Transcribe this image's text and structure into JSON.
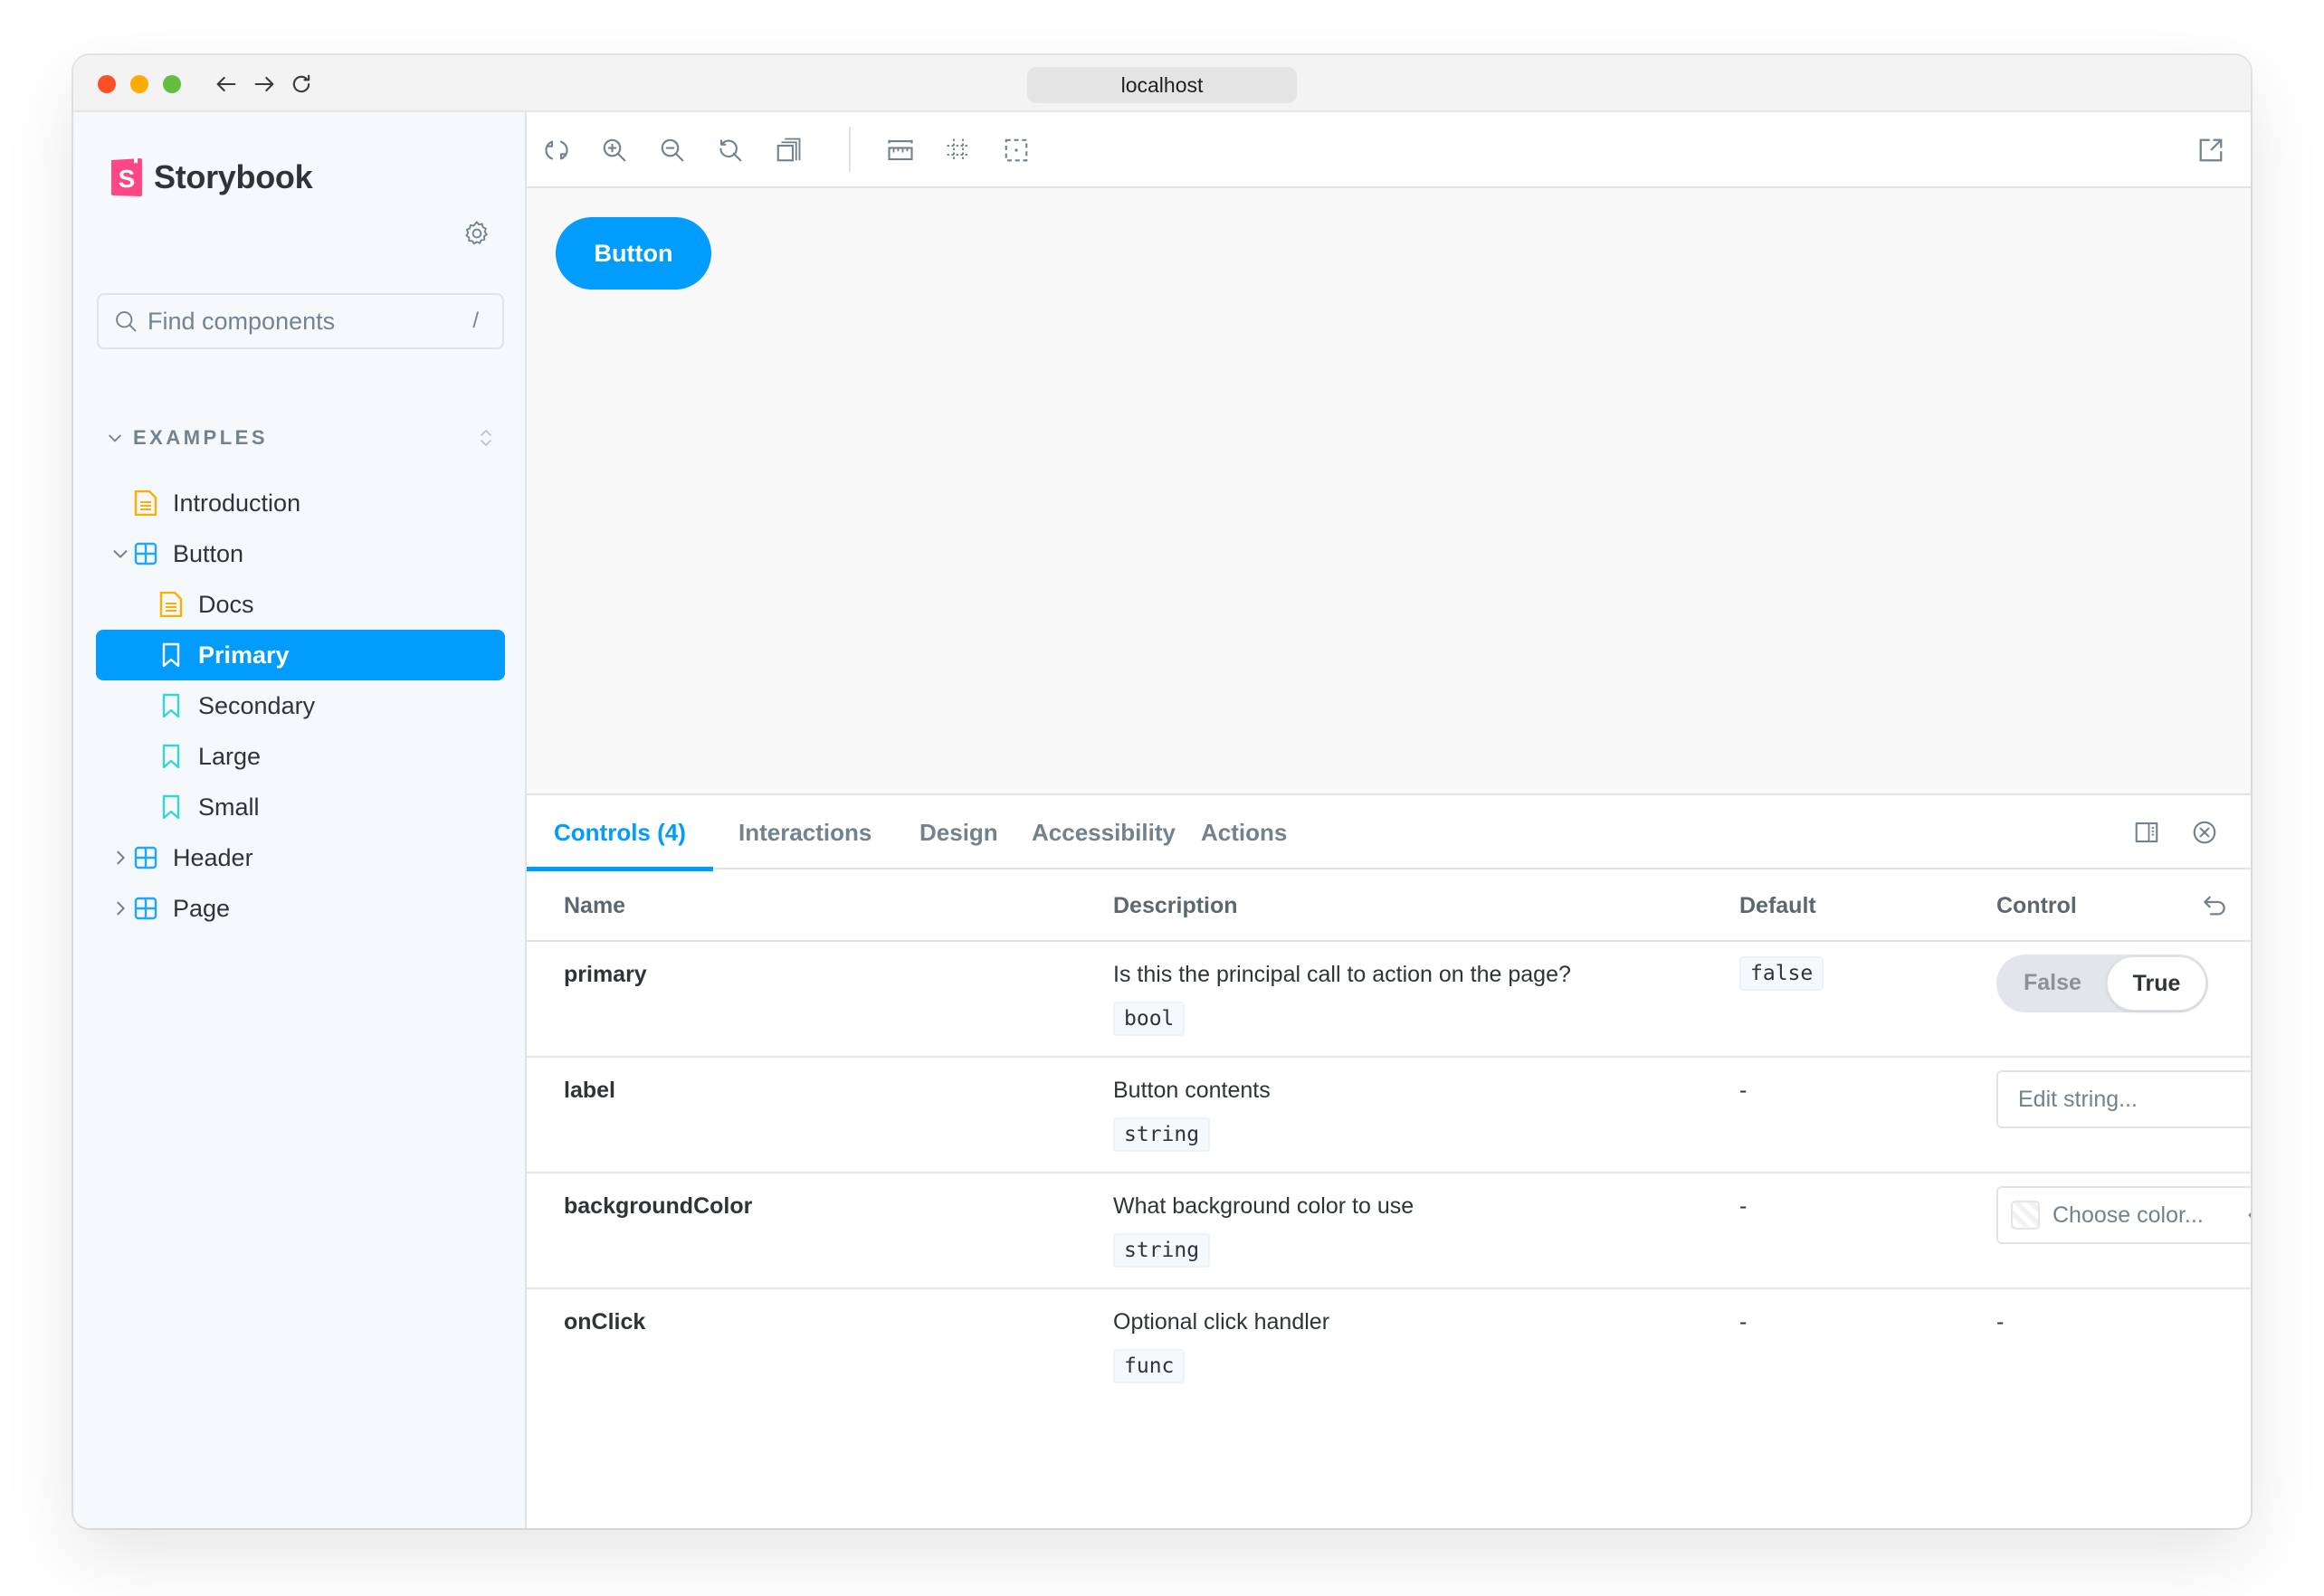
{
  "browser": {
    "url": "localhost",
    "icons": [
      "arrow-left-icon",
      "arrow-right-icon",
      "reload-icon"
    ]
  },
  "sidebar": {
    "brand": "Storybook",
    "search": {
      "placeholder": "Find components",
      "shortcut": "/"
    },
    "section": "EXAMPLES",
    "items": [
      {
        "label": "Introduction",
        "type": "docs",
        "level": 0
      },
      {
        "label": "Button",
        "type": "component",
        "level": 0,
        "expanded": true
      },
      {
        "label": "Docs",
        "type": "docs",
        "level": 1
      },
      {
        "label": "Primary",
        "type": "story",
        "level": 1,
        "selected": true
      },
      {
        "label": "Secondary",
        "type": "story",
        "level": 1
      },
      {
        "label": "Large",
        "type": "story",
        "level": 1
      },
      {
        "label": "Small",
        "type": "story",
        "level": 1
      },
      {
        "label": "Header",
        "type": "component",
        "level": 0,
        "expanded": false
      },
      {
        "label": "Page",
        "type": "component",
        "level": 0,
        "expanded": false
      }
    ]
  },
  "toolbar": {
    "tools": [
      "remount-icon",
      "zoom-in-icon",
      "zoom-out-icon",
      "zoom-reset-icon",
      "background-icon",
      "measure-icon",
      "grid-icon",
      "outline-icon"
    ],
    "open_new_tab": "open-in-new-tab-icon"
  },
  "preview": {
    "button_label": "Button"
  },
  "panel": {
    "tabs": [
      {
        "label": "Controls (4)",
        "active": true
      },
      {
        "label": "Interactions"
      },
      {
        "label": "Design"
      },
      {
        "label": "Accessibility"
      },
      {
        "label": "Actions"
      }
    ],
    "columns": {
      "name": "Name",
      "description": "Description",
      "default": "Default",
      "control": "Control"
    },
    "rows": [
      {
        "name": "primary",
        "description": "Is this the principal call to action on the page?",
        "type": "bool",
        "default": "false",
        "control": {
          "kind": "boolean",
          "false_label": "False",
          "true_label": "True",
          "value": true
        }
      },
      {
        "name": "label",
        "description": "Button contents",
        "type": "string",
        "default": "-",
        "control": {
          "kind": "text",
          "placeholder": "Edit string..."
        }
      },
      {
        "name": "backgroundColor",
        "description": "What background color to use",
        "type": "string",
        "default": "-",
        "control": {
          "kind": "color",
          "placeholder": "Choose color..."
        }
      },
      {
        "name": "onClick",
        "description": "Optional click handler",
        "type": "func",
        "default": "-",
        "control": {
          "kind": "none",
          "text": "-"
        }
      }
    ]
  },
  "colors": {
    "accent": "#029CFD",
    "brand_pink": "#FF4785",
    "docs_icon": "#FFAE00",
    "component_icon": "#1EA7FD",
    "story_icon": "#37D5D3"
  }
}
